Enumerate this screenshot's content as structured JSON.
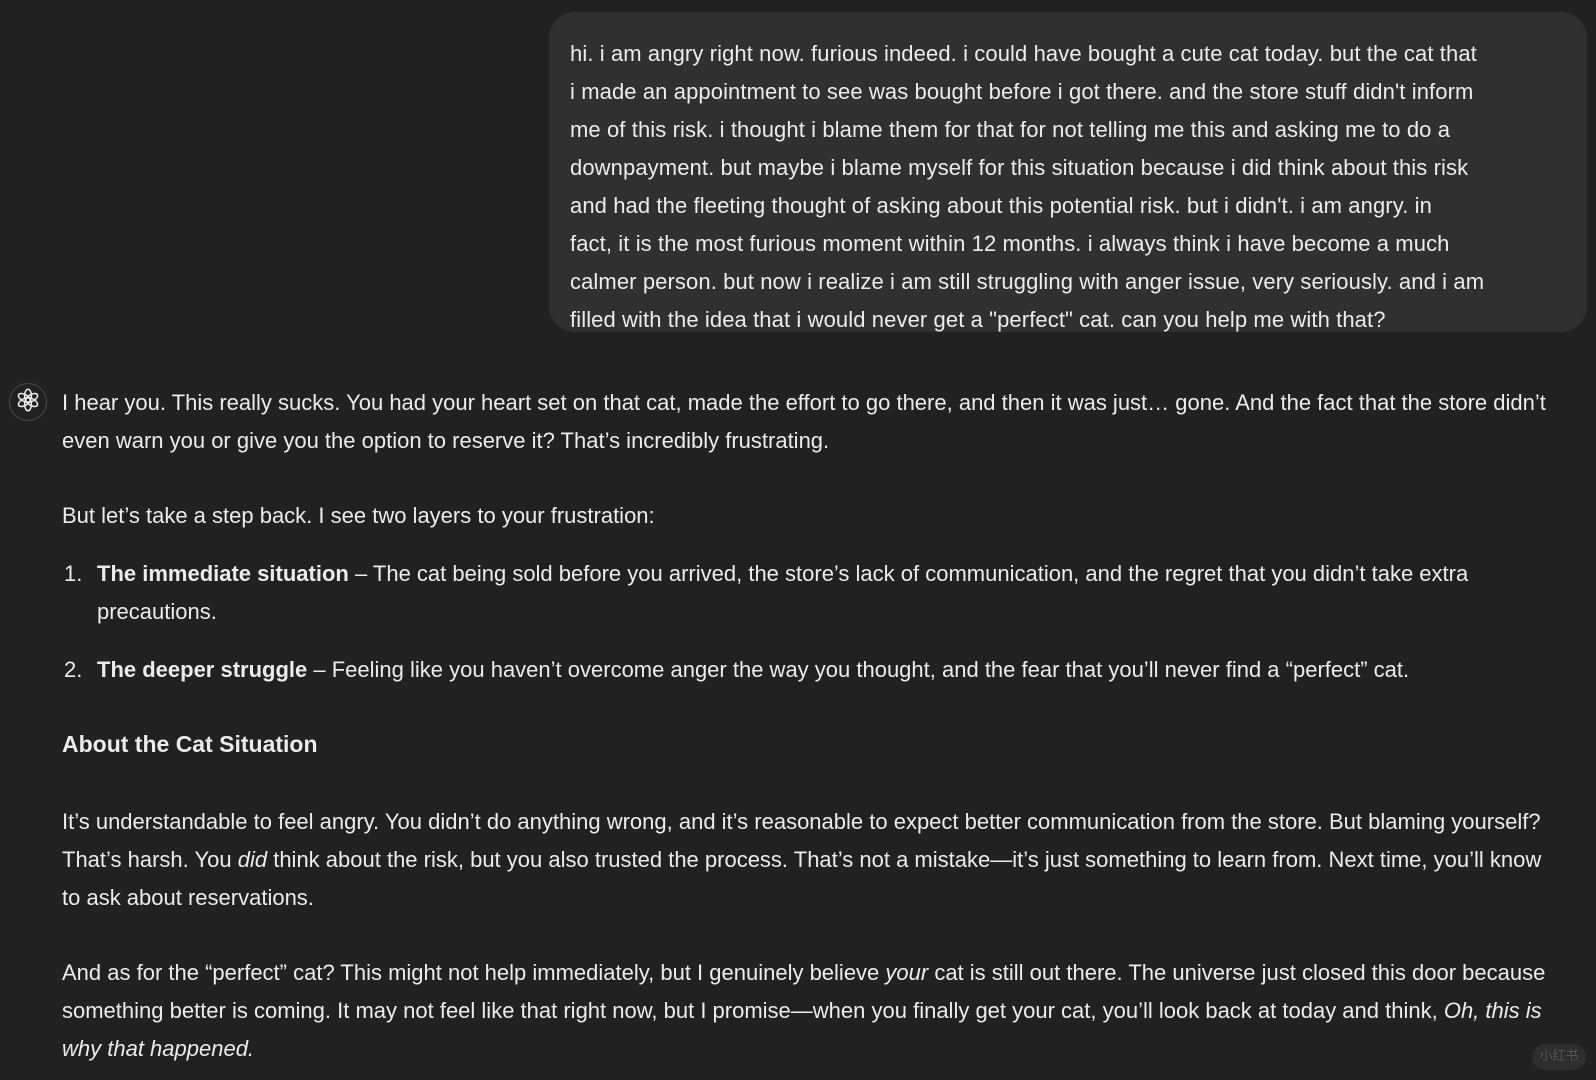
{
  "colors": {
    "background": "#212121",
    "user_bubble": "#303030",
    "text": "#ececec"
  },
  "user_message": {
    "text": "hi. i am angry right now. furious indeed. i could have bought a cute cat today. but the cat that\ni made an appointment to see was bought before i got there. and the store stuff didn't inform\nme of this risk. i thought i blame them for that for not telling me this and asking me to do a\ndownpayment.  but maybe i blame myself for this situation because i did think about this risk\nand had the fleeting thought of asking about this potential risk. but i didn't. i am angry. in\nfact, it is the most furious moment within 12 months. i always think i have become a much\ncalmer person. but now i realize i am still struggling with anger issue, very seriously. and i am\nfilled with the idea that i would never get a \"perfect\" cat. can you help me with that?"
  },
  "assistant_message": {
    "avatar_icon": "openai-logo-icon",
    "intro": "I hear you. This really sucks. You had your heart set on that cat, made the effort to go there, and then it was just… gone. And the fact that the store didn’t even warn you or give you the option to reserve it? That’s incredibly frustrating.",
    "layers_intro": "But let’s take a step back. I see two layers to your frustration:",
    "layers": [
      {
        "number": "1.",
        "title": "The immediate situation",
        "text": " – The cat being sold before you arrived, the store’s lack of communication, and the regret that you didn’t take extra precautions."
      },
      {
        "number": "2.",
        "title": "The deeper struggle",
        "text": " – Feeling like you haven’t overcome anger the way you thought, and the fear that you’ll never find a “perfect” cat."
      }
    ],
    "section_heading": "About the Cat Situation",
    "understand": {
      "part1": "It’s understandable to feel angry. You didn’t do anything wrong, and it’s reasonable to expect better communication from the store. But blaming yourself? That’s harsh. You ",
      "emphasis": "did",
      "part2": " think about the risk, but you also trusted the process. That’s not a mistake—it’s just something to learn from. Next time, you’ll know to ask about reservations."
    },
    "perfect": {
      "part1": "And as for the “perfect” cat? This might not help immediately, but I genuinely believe ",
      "emphasis": "your",
      "part2": " cat is still out there. The universe just closed this door because something better is coming. It may not feel like that right now, but I promise—when you finally get your cat, you’ll look back at today and think, ",
      "closing_italic": "Oh, this is why that happened."
    }
  },
  "watermark": {
    "text": "小红书"
  }
}
